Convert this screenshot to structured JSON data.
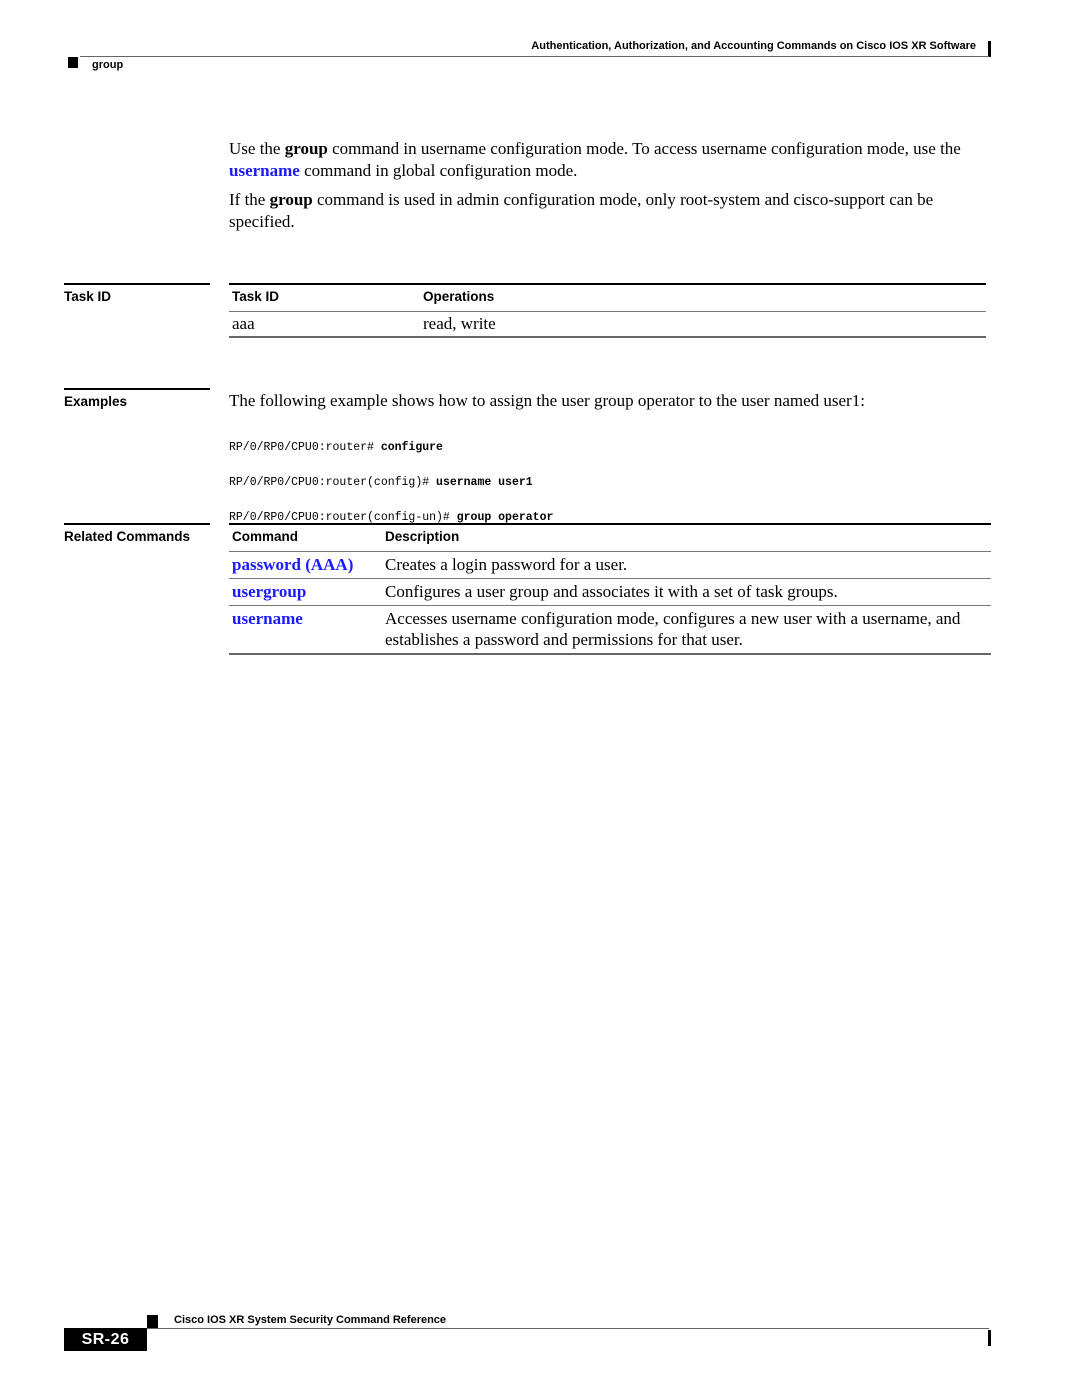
{
  "header": {
    "chapter_title": "Authentication, Authorization, and Accounting Commands on Cisco IOS XR Software",
    "command_name": "group"
  },
  "usage": {
    "p1": {
      "t1": "Use the ",
      "b1": "group",
      "t2": " command in username configuration mode. To access username configuration mode, use the ",
      "link": "username",
      "t3": " command in global configuration mode."
    },
    "p2": {
      "t1": "If the ",
      "b1": "group",
      "t2": " command is used in admin configuration mode, only root-system and cisco-support can be specified."
    }
  },
  "task_id_section": {
    "label": "Task ID",
    "headers": [
      "Task ID",
      "Operations"
    ],
    "rows": [
      {
        "task_id": "aaa",
        "operations": "read, write"
      }
    ]
  },
  "examples_section": {
    "label": "Examples",
    "intro": "The following example shows how to assign the user group operator to the user named user1:",
    "code_lines": [
      {
        "prompt": "RP/0/RP0/CPU0:router# ",
        "command": "configure"
      },
      {
        "prompt": "RP/0/RP0/CPU0:router(config)# ",
        "command": "username user1"
      },
      {
        "prompt": "RP/0/RP0/CPU0:router(config-un)# ",
        "command": "group operator"
      }
    ]
  },
  "related_commands_section": {
    "label": "Related Commands",
    "headers": [
      "Command",
      "Description"
    ],
    "rows": [
      {
        "command": "password (AAA)",
        "description": "Creates a login password for a user."
      },
      {
        "command": "usergroup",
        "description": "Configures a user group and associates it with a set of task groups."
      },
      {
        "command": "username",
        "description": "Accesses username configuration mode, configures a new user with a username, and establishes a password and permissions for that user."
      }
    ]
  },
  "footer": {
    "book_title": "Cisco IOS XR System Security Command Reference",
    "page_number": "SR-26"
  },
  "colors": {
    "link": "#1a1aff",
    "text": "#000000",
    "rule": "#666666"
  }
}
